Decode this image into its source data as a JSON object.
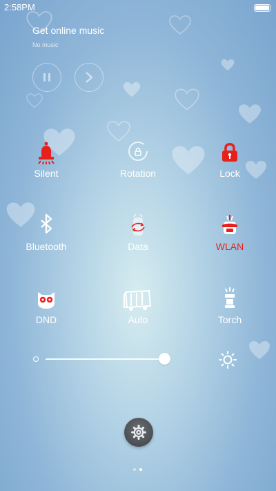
{
  "status": {
    "time": "2:58PM"
  },
  "music": {
    "title": "Get online music",
    "subtitle": "No music"
  },
  "toggles": [
    {
      "label": "Silent",
      "icon": "bell-icon",
      "active": true
    },
    {
      "label": "Rotation",
      "icon": "rotation-lock-icon",
      "active": false
    },
    {
      "label": "Lock",
      "icon": "padlock-icon",
      "active": true
    },
    {
      "label": "Bluetooth",
      "icon": "bluetooth-icon",
      "active": false
    },
    {
      "label": "Data",
      "icon": "mobile-data-icon",
      "active": false
    },
    {
      "label": "WLAN",
      "icon": "wifi-icon",
      "active": true
    },
    {
      "label": "DND",
      "icon": "owl-icon",
      "active": false
    },
    {
      "label": "Auto",
      "icon": "auto-brightness-icon",
      "active": false
    },
    {
      "label": "Torch",
      "icon": "flashlight-icon",
      "active": false
    }
  ],
  "brightness": {
    "level": 1.0
  },
  "pager": {
    "pages": 2,
    "current": 2
  },
  "colors": {
    "active_red": "#e8201c",
    "text": "#ffffff"
  }
}
